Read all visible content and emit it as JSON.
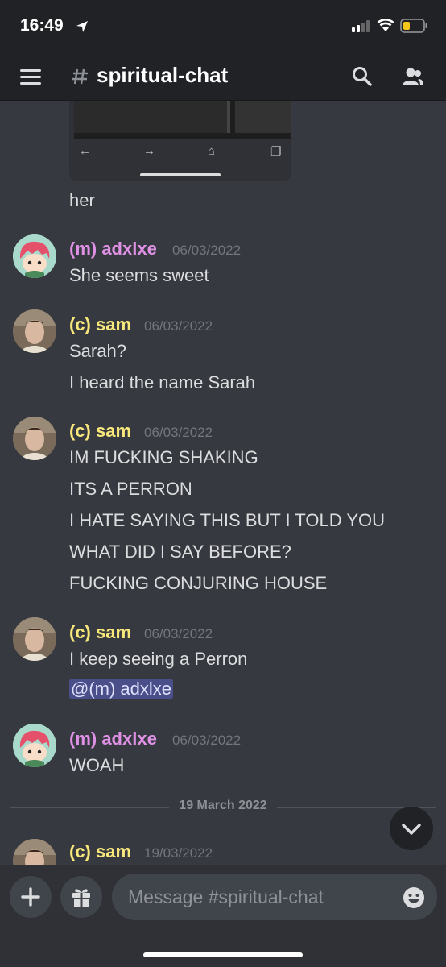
{
  "status_bar": {
    "time": "16:49"
  },
  "header": {
    "channel": "spiritual-chat"
  },
  "embed": {
    "prev_text": "her"
  },
  "messages": [
    {
      "author": "(m) adxlxe",
      "timestamp": "06/03/2022",
      "lines": [
        "She seems sweet"
      ]
    },
    {
      "author": "(c) sam",
      "timestamp": "06/03/2022",
      "lines": [
        "Sarah?",
        "I heard the name Sarah"
      ]
    },
    {
      "author": "(c) sam",
      "timestamp": "06/03/2022",
      "lines": [
        "IM FUCKING SHAKING",
        "ITS A PERRON",
        "I HATE SAYING THIS BUT I TOLD YOU",
        "WHAT DID I SAY BEFORE?",
        "FUCKING CONJURING HOUSE"
      ]
    },
    {
      "author": "(c) sam",
      "timestamp": "06/03/2022",
      "lines": [
        "I keep seeing a Perron"
      ],
      "mention": "@(m) adxlxe"
    },
    {
      "author": "(m) adxlxe",
      "timestamp": "06/03/2022",
      "lines": [
        "WOAH"
      ]
    },
    {
      "author": "(c) sam",
      "timestamp": "19/03/2022",
      "lines": []
    }
  ],
  "date_divider": "19 March 2022",
  "composer": {
    "placeholder": "Message #spiritual-chat"
  },
  "colors": {
    "background": "#36393f",
    "bar": "#202225",
    "adxlxe": "#e091e6",
    "sam": "#f8e87c",
    "mention_bg": "#4a4f8a"
  }
}
